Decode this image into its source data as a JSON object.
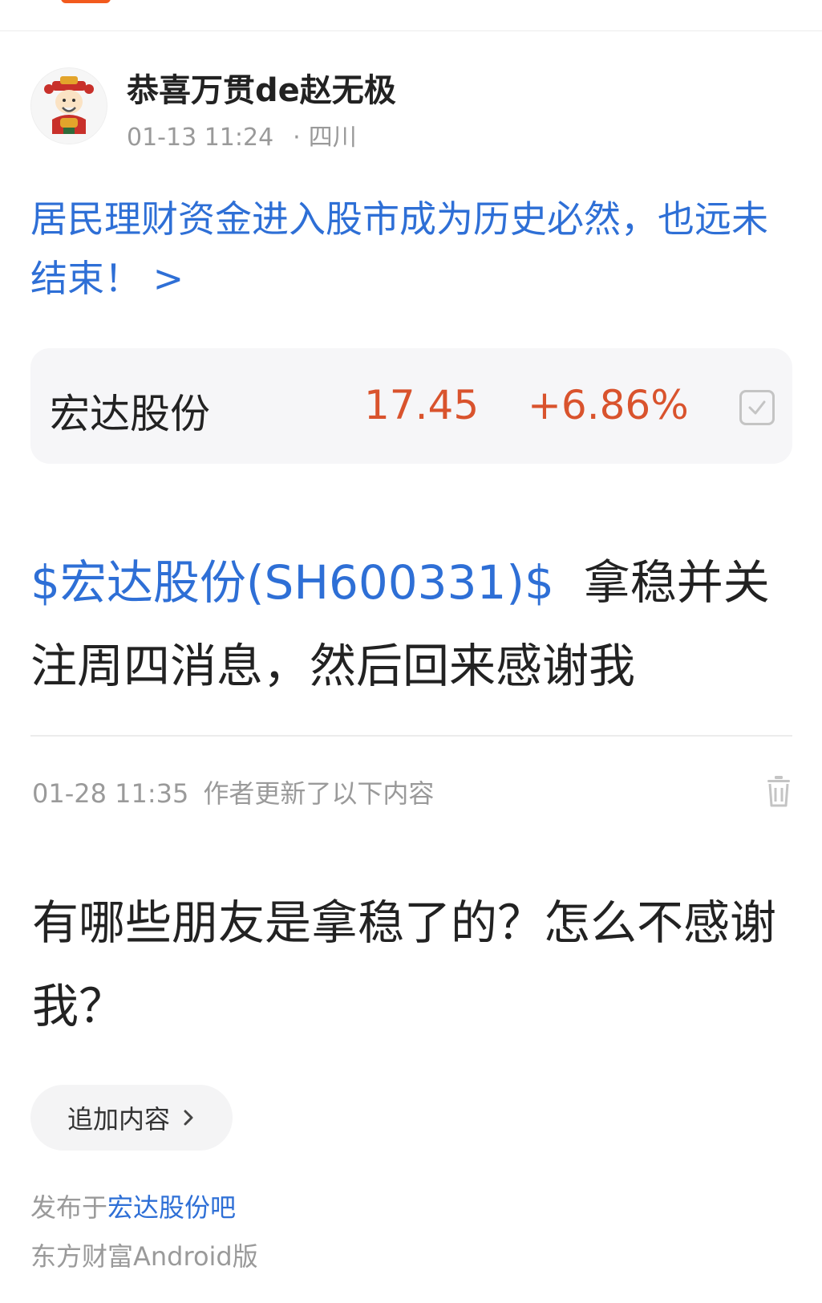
{
  "author": {
    "name": "恭喜万贯de赵无极",
    "time": "01-13 11:24",
    "location_sep": "·",
    "location": "四川",
    "avatar_icon": "cartoon-god-of-wealth-avatar"
  },
  "headline": {
    "text": "居民理财资金进入股市成为历史必然，也远未结束！",
    "arrow": ">"
  },
  "stock_card": {
    "name": "宏达股份",
    "price": "17.45",
    "change": "+6.86%",
    "icon": "checkbox-icon"
  },
  "post": {
    "stock_tag": "$宏达股份(SH600331)$",
    "text": "拿稳并关注周四消息，然后回来感谢我"
  },
  "update": {
    "time": "01-28 11:35",
    "label": "作者更新了以下内容",
    "text": "有哪些朋友是拿稳了的？怎么不感谢我？",
    "delete_icon": "trash-icon"
  },
  "add_button": {
    "label": "追加内容",
    "icon": "chevron-right-icon"
  },
  "footer": {
    "published_prefix": "发布于",
    "bar_name": "宏达股份吧",
    "client": "东方财富Android版"
  },
  "colors": {
    "link_blue": "#2e6fd6",
    "price_red": "#d9532d",
    "muted": "#9a9a9a",
    "accent_orange": "#f25a1d"
  }
}
